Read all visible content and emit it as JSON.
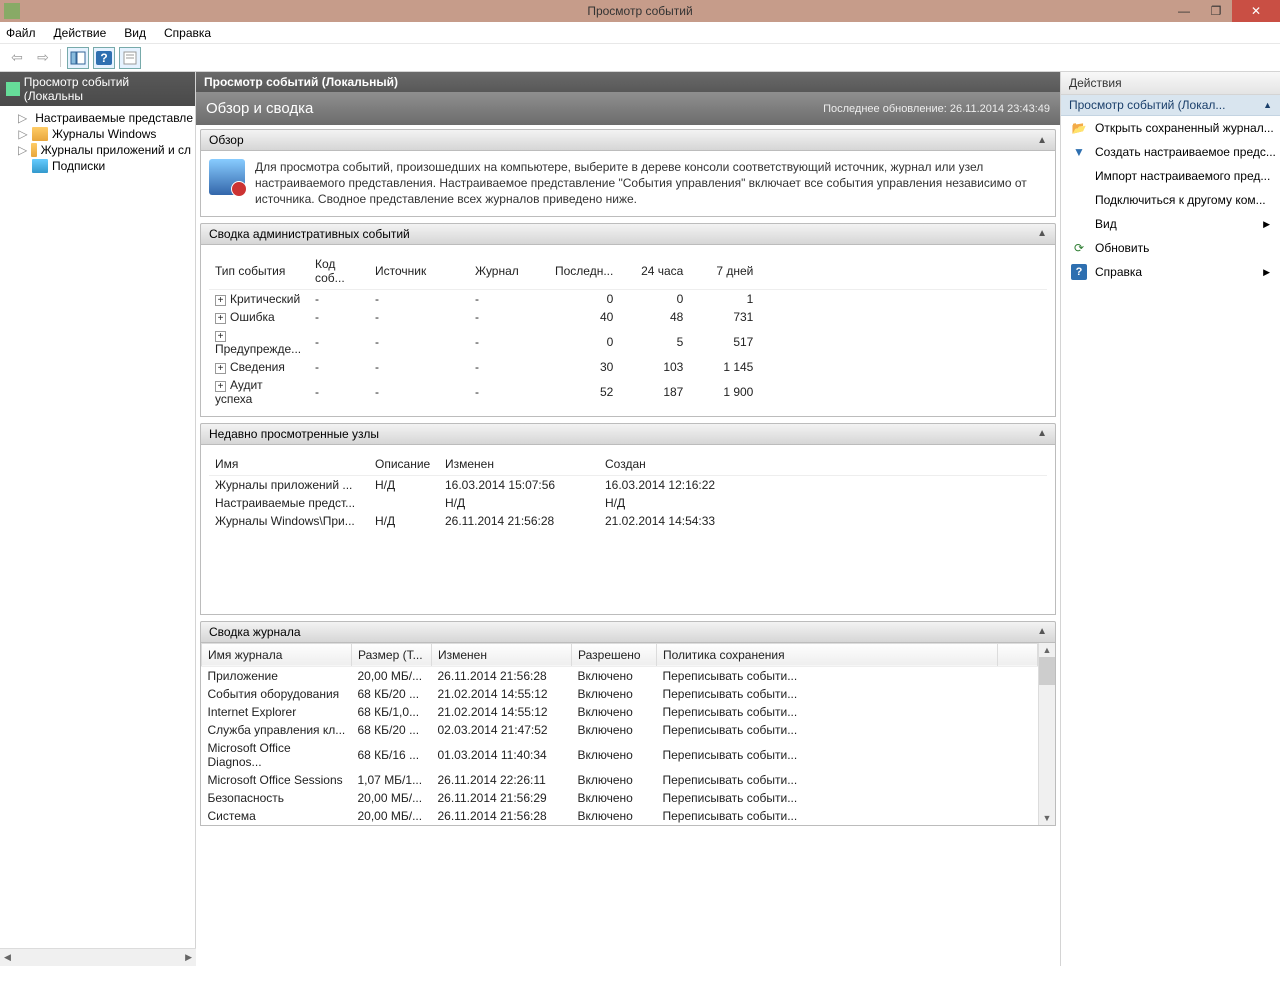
{
  "window": {
    "title": "Просмотр событий"
  },
  "menu": {
    "file": "Файл",
    "action": "Действие",
    "view": "Вид",
    "help": "Справка"
  },
  "tree": {
    "root": "Просмотр событий (Локальны",
    "items": [
      {
        "exp": "▷",
        "label": "Настраиваемые представле"
      },
      {
        "exp": "▷",
        "label": "Журналы Windows"
      },
      {
        "exp": "▷",
        "label": "Журналы приложений и сл"
      },
      {
        "exp": "",
        "label": "Подписки"
      }
    ]
  },
  "content": {
    "header": "Просмотр событий (Локальный)",
    "title": "Обзор и сводка",
    "updated": "Последнее обновление: 26.11.2014 23:43:49",
    "overview_hdr": "Обзор",
    "overview_text": "Для просмотра событий, произошедших на компьютере, выберите в дереве консоли соответствующий источник, журнал или узел настраиваемого представления. Настраиваемое представление \"События управления\" включает все события управления независимо от источника. Сводное представление всех журналов приведено ниже.",
    "admin_hdr": "Сводка административных событий",
    "admin_cols": {
      "type": "Тип события",
      "code": "Код соб...",
      "source": "Источник",
      "log": "Журнал",
      "last": "Последн...",
      "h24": "24 часа",
      "d7": "7 дней"
    },
    "admin_rows": [
      {
        "type": "Критический",
        "code": "-",
        "source": "-",
        "log": "-",
        "last": "0",
        "h24": "0",
        "d7": "1"
      },
      {
        "type": "Ошибка",
        "code": "-",
        "source": "-",
        "log": "-",
        "last": "40",
        "h24": "48",
        "d7": "731"
      },
      {
        "type": "Предупрежде...",
        "code": "-",
        "source": "-",
        "log": "-",
        "last": "0",
        "h24": "5",
        "d7": "517"
      },
      {
        "type": "Сведения",
        "code": "-",
        "source": "-",
        "log": "-",
        "last": "30",
        "h24": "103",
        "d7": "1 145"
      },
      {
        "type": "Аудит успеха",
        "code": "-",
        "source": "-",
        "log": "-",
        "last": "52",
        "h24": "187",
        "d7": "1 900"
      }
    ],
    "recent_hdr": "Недавно просмотренные узлы",
    "recent_cols": {
      "name": "Имя",
      "desc": "Описание",
      "mod": "Изменен",
      "created": "Создан"
    },
    "recent_rows": [
      {
        "name": "Журналы приложений ...",
        "desc": "Н/Д",
        "mod": "16.03.2014 15:07:56",
        "created": "16.03.2014 12:16:22"
      },
      {
        "name": "Настраиваемые предст...",
        "desc": "",
        "mod": "Н/Д",
        "created": "Н/Д"
      },
      {
        "name": "Журналы Windows\\При...",
        "desc": "Н/Д",
        "mod": "26.11.2014 21:56:28",
        "created": "21.02.2014 14:54:33"
      }
    ],
    "logs_hdr": "Сводка журнала",
    "logs_cols": {
      "name": "Имя журнала",
      "size": "Размер (Т...",
      "mod": "Изменен",
      "enabled": "Разрешено",
      "policy": "Политика сохранения"
    },
    "logs_rows": [
      {
        "name": "Приложение",
        "size": "20,00 МБ/...",
        "mod": "26.11.2014 21:56:28",
        "enabled": "Включено",
        "policy": "Переписывать событи..."
      },
      {
        "name": "События оборудования",
        "size": "68 КБ/20 ...",
        "mod": "21.02.2014 14:55:12",
        "enabled": "Включено",
        "policy": "Переписывать событи..."
      },
      {
        "name": "Internet Explorer",
        "size": "68 КБ/1,0...",
        "mod": "21.02.2014 14:55:12",
        "enabled": "Включено",
        "policy": "Переписывать событи..."
      },
      {
        "name": "Служба управления кл...",
        "size": "68 КБ/20 ...",
        "mod": "02.03.2014 21:47:52",
        "enabled": "Включено",
        "policy": "Переписывать событи..."
      },
      {
        "name": "Microsoft Office Diagnos...",
        "size": "68 КБ/16 ...",
        "mod": "01.03.2014 11:40:34",
        "enabled": "Включено",
        "policy": "Переписывать событи..."
      },
      {
        "name": "Microsoft Office Sessions",
        "size": "1,07 МБ/1...",
        "mod": "26.11.2014 22:26:11",
        "enabled": "Включено",
        "policy": "Переписывать событи..."
      },
      {
        "name": "Безопасность",
        "size": "20,00 МБ/...",
        "mod": "26.11.2014 21:56:29",
        "enabled": "Включено",
        "policy": "Переписывать событи..."
      },
      {
        "name": "Система",
        "size": "20,00 МБ/...",
        "mod": "26.11.2014 21:56:28",
        "enabled": "Включено",
        "policy": "Переписывать событи..."
      }
    ]
  },
  "actions": {
    "header": "Действия",
    "context": "Просмотр событий (Локал...",
    "items": [
      {
        "icon": "open",
        "label": "Открыть сохраненный журнал..."
      },
      {
        "icon": "filter",
        "label": "Создать настраиваемое предс..."
      },
      {
        "icon": "",
        "label": "Импорт настраиваемого пред..."
      },
      {
        "icon": "",
        "label": "Подключиться к другому ком..."
      },
      {
        "icon": "",
        "label": "Вид",
        "sub": true
      },
      {
        "icon": "refresh",
        "label": "Обновить"
      },
      {
        "icon": "help",
        "label": "Справка",
        "sub": true
      }
    ]
  }
}
